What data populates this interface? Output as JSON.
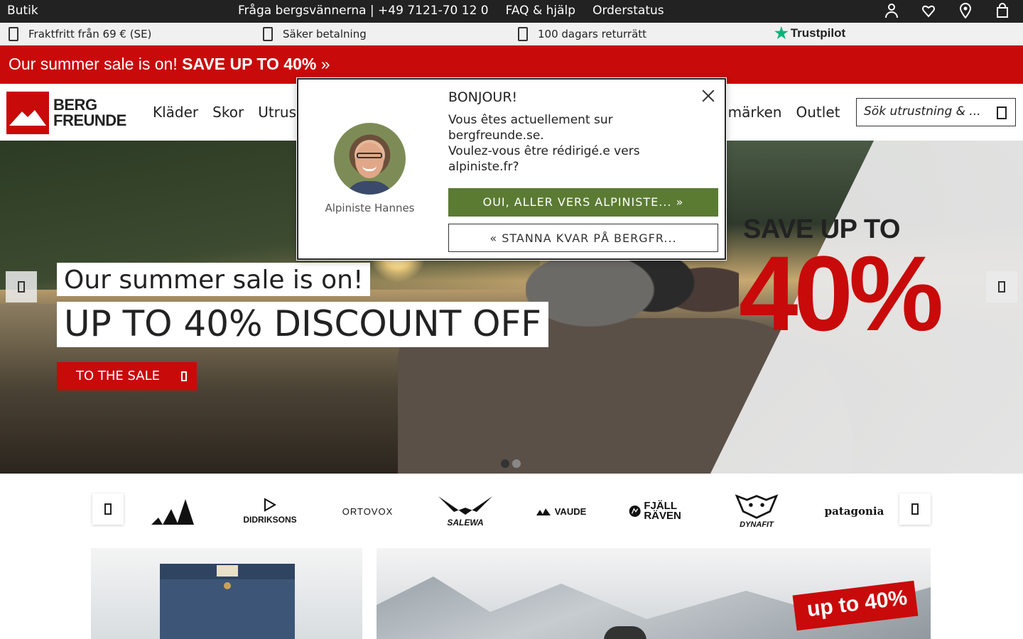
{
  "topbar": {
    "shop": "Butik",
    "contact": "Fråga bergsvännerna | +49 7121-70 12 0",
    "faq": "FAQ & hjälp",
    "order_status": "Orderstatus",
    "icons": [
      "user-icon",
      "heart-icon",
      "location-icon",
      "cart-icon"
    ]
  },
  "usp": {
    "shipping": "Fraktfritt från 69 € (SE)",
    "payment": "Säker betalning",
    "returns": "100 dagars returrätt",
    "trustpilot": "Trustpilot"
  },
  "sale_banner": {
    "lead": "Our summer sale is on! ",
    "strong": "SAVE UP TO 40%",
    "arrows": "»"
  },
  "header": {
    "logo_line1": "BERG",
    "logo_line2": "FREUNDE",
    "nav": [
      "Kläder",
      "Skor",
      "Utrus"
    ],
    "nav_right": [
      "umärken",
      "Outlet"
    ],
    "search_placeholder": "Sök utrustning & ..."
  },
  "hero": {
    "headline_small": "Our summer sale is on!",
    "headline_big": "UP TO 40% DISCOUNT OFF",
    "cta": "TO THE SALE",
    "save_up_to": "SAVE UP TO",
    "percent": "40%"
  },
  "brands": [
    {
      "label": "adidas"
    },
    {
      "label": "DIDRIKSONS"
    },
    {
      "label": "ORTOVOX"
    },
    {
      "label": "SALEWA"
    },
    {
      "label": "VAUDE"
    },
    {
      "label": "FJÄLL RÄVEN"
    },
    {
      "label": "DYNAFIT"
    },
    {
      "label": "patagonia"
    }
  ],
  "promo": {
    "badge": "up to 40%"
  },
  "modal": {
    "agent_name": "Alpiniste Hannes",
    "greeting": "BONJOUR!",
    "line1": "Vous êtes actuellement sur",
    "line2": "bergfreunde.se.",
    "line3": "Voulez-vous être rédirigé.e vers",
    "line4": "alpiniste.fr?",
    "yes_button": "OUI, ALLER VERS ALPINISTE...  »",
    "stay_button": "«  STANNA KVAR PÅ BERGFR..."
  },
  "colors": {
    "brand_red": "#c80a0a",
    "confirm_green": "#5b7b33",
    "topbar_bg": "#222222"
  }
}
